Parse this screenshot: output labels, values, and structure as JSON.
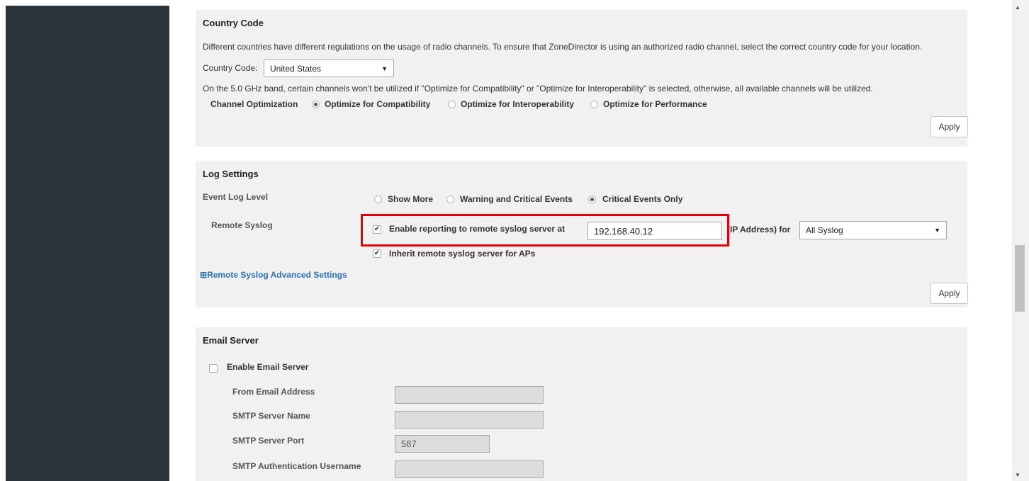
{
  "country_code": {
    "title": "Country Code",
    "description": "Different countries have different regulations on the usage of radio channels. To ensure that ZoneDirector is using an authorized radio channel, select the correct country code for your location.",
    "field_label": "Country Code:",
    "selected": "United States",
    "band_note": "On the 5.0 GHz band, certain channels won't be utilized if \"Optimize for Compatibility\" or \"Optimize for Interoperability\" is selected, otherwise, all available channels will be utilized.",
    "channel_opt_label": "Channel Optimization",
    "options": [
      "Optimize for Compatibility",
      "Optimize for Interoperability",
      "Optimize for Performance"
    ],
    "selected_option": "Optimize for Compatibility",
    "apply": "Apply"
  },
  "log_settings": {
    "title": "Log Settings",
    "event_log_label": "Event Log Level",
    "event_options": [
      "Show More",
      "Warning and Critical Events",
      "Critical Events Only"
    ],
    "selected_event_option": "Critical Events Only",
    "remote_syslog_label": "Remote Syslog",
    "enable_remote_label": "Enable reporting to remote syslog server at",
    "enable_remote_checked": true,
    "syslog_ip": "192.168.40.12",
    "ip_suffix": "(IP Address) for",
    "syslog_type": "All Syslog",
    "inherit_label": "Inherit remote syslog server for APs",
    "inherit_checked": true,
    "advanced_link": "Remote Syslog Advanced Settings",
    "expand_icon": "⊞",
    "apply": "Apply"
  },
  "email_server": {
    "title": "Email Server",
    "enable_label": "Enable Email Server",
    "enable_checked": false,
    "from_label": "From Email Address",
    "from_value": "",
    "smtp_name_label": "SMTP Server Name",
    "smtp_name_value": "",
    "smtp_port_label": "SMTP Server Port",
    "smtp_port_value": "587",
    "smtp_user_label": "SMTP Authentication Username",
    "smtp_user_value": ""
  },
  "icons": {
    "dropdown": "▼",
    "check": "✔",
    "scroll_up": "▲",
    "scroll_down": "▼"
  },
  "colors": {
    "sidebar": "#2b333b",
    "panel": "#f1f1f1",
    "highlight": "#e3000b",
    "link": "#2a6fb5"
  }
}
